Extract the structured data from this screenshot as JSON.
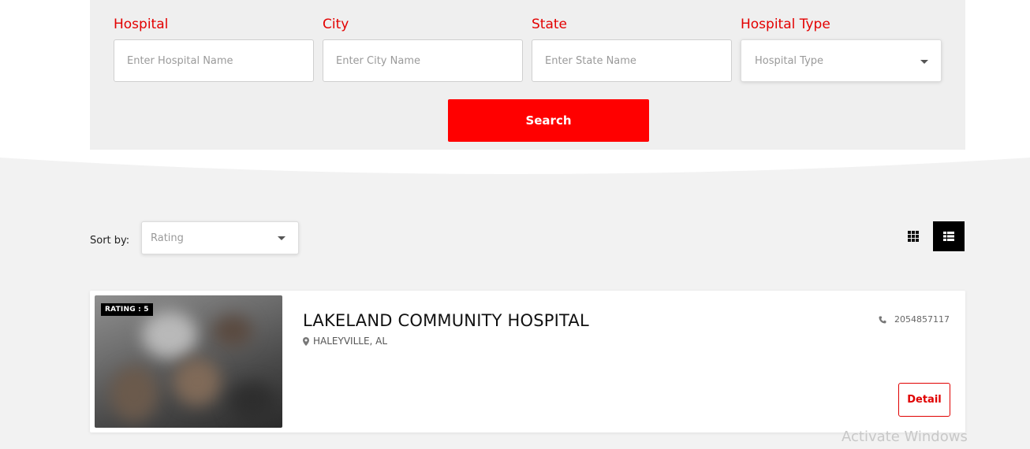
{
  "search_form": {
    "hospital": {
      "label": "Hospital",
      "placeholder": "Enter Hospital Name"
    },
    "city": {
      "label": "City",
      "placeholder": "Enter City Name"
    },
    "state": {
      "label": "State",
      "placeholder": "Enter State Name"
    },
    "hospital_type": {
      "label": "Hospital Type",
      "selected": "Hospital Type"
    },
    "search_button": "Search"
  },
  "results_toolbar": {
    "sort_label": "Sort by:",
    "sort_selected": "Rating",
    "view_modes": [
      "grid-view-icon",
      "list-view-icon"
    ],
    "active_view": "list"
  },
  "results": [
    {
      "name": "LAKELAND COMMUNITY HOSPITAL",
      "location": "HALEYVILLE, AL",
      "phone": "2054857117",
      "rating_badge": "RATING : 5",
      "detail_label": "Detail"
    }
  ],
  "system": {
    "watermark": "Activate Windows"
  },
  "colors": {
    "accent": "#ff0000",
    "label_red": "#e30000",
    "page_bg": "#f2f2f2",
    "panel_bg": "#efefef"
  }
}
